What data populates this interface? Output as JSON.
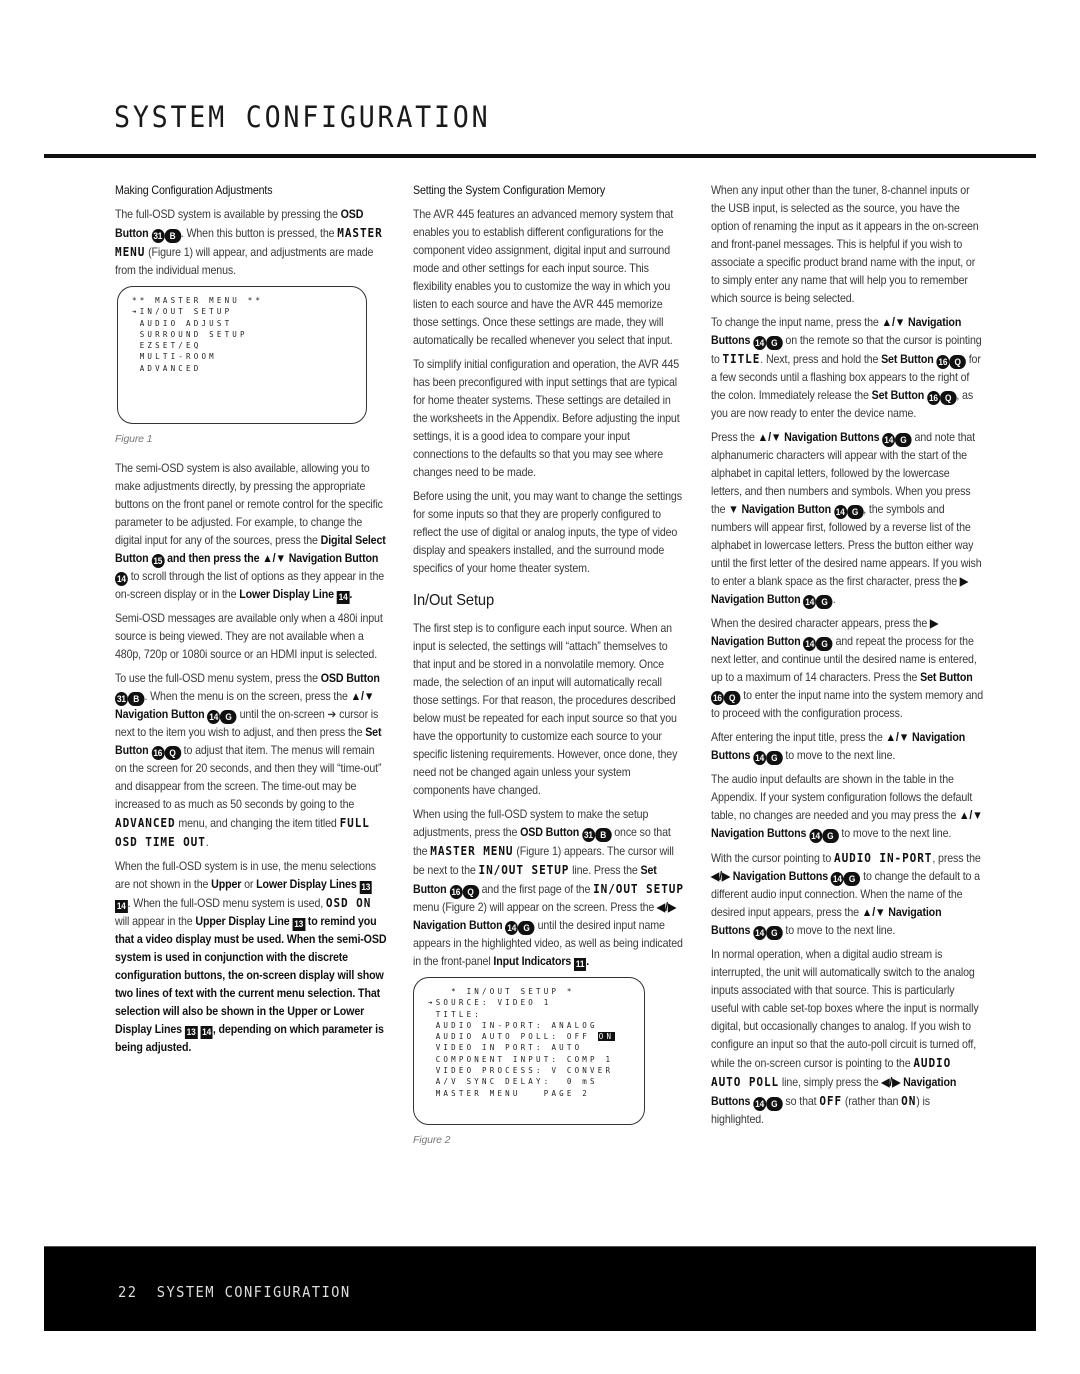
{
  "header": {
    "title": "SYSTEM CONFIGURATION"
  },
  "column1": {
    "heading": "Making Configuration Adjustments",
    "p1": [
      "The full-OSD system is available by pressing the ",
      "OSD Button",
      "31",
      "B",
      ". When this button is pressed, the ",
      "MASTER MENU",
      " (Figure 1) will appear, and adjustments are made from the individual menus."
    ],
    "figure1": {
      "lines": [
        "** MASTER MENU **",
        "",
        "→IN/OUT SETUP",
        " AUDIO ADJUST",
        " SURROUND SETUP",
        " EZSET/EQ",
        " MULTI-ROOM",
        " ADVANCED"
      ],
      "caption": "Figure 1"
    },
    "p2": [
      "The semi-OSD system is also available, allowing you to make adjustments directly, by pressing the appropriate buttons on the front panel or remote control for the specific parameter to be adjusted. For example, to change the digital input for any of the sources, press the ",
      "Digital Select Button",
      "15",
      " and then press the ",
      "▲/▼ Navigation Button",
      "14",
      " to scroll through the list of options as they appear in the on-screen display or in the ",
      "Lower Display Line",
      "14",
      "."
    ],
    "p3": "Semi-OSD messages are available only when a 480i input source is being viewed. They are not available when a 480p, 720p or 1080i source or an HDMI input is selected.",
    "p4": [
      "To use the full-OSD menu system, press the ",
      "OSD Button",
      "31",
      "B",
      ". When the menu is on the screen, press the ",
      "▲/▼ Navigation Button",
      "14",
      "G",
      " until the on-screen ➔ cursor is next to the item you wish to adjust, and then press the ",
      "Set Button",
      "16",
      "Q",
      " to adjust that item. The menus will remain on the screen for 20 seconds, and then they will “time-out” and disappear from the screen. The time-out may be increased to as much as 50 seconds by going to the ",
      "ADVANCED",
      " menu, and changing the item titled ",
      "FULL OSD TIME OUT",
      "."
    ],
    "p5": [
      "When the full-OSD system is in use, the menu selections are not shown in the ",
      "Upper",
      " or ",
      "Lower Display Lines",
      "13",
      "14",
      ". When the full-OSD menu system is used, ",
      "OSD ON",
      " will appear in the ",
      "Upper Display Line",
      "13",
      " to remind you that a video display must be used. When the semi-OSD system is used in conjunction with the discrete configuration buttons, the on-screen display will show two lines of text with the current menu selection. That selection will also be shown in the ",
      "Upper",
      " or ",
      "Lower Display Lines",
      "13",
      "14",
      ", depending on which parameter is being adjusted."
    ]
  },
  "column2": {
    "heading": "Setting the System Configuration Memory",
    "p1": "The AVR 445 features an advanced memory system that enables you to establish different configurations for the component video assignment, digital input and surround mode and other settings for each input source. This flexibility enables you to customize the way in which you listen to each source and have the AVR 445 memorize those settings. Once these settings are made, they will automatically be recalled whenever you select that input.",
    "p2": "To simplify initial configuration and operation, the AVR 445 has been preconfigured with input settings that are typical for home theater systems. These settings are detailed in the worksheets in the Appendix. Before adjusting the input settings, it is a good idea to compare your input connections to the defaults so that you may see where changes need to be made.",
    "p3": "Before using the unit, you may want to change the settings for some inputs so that they are properly configured to reflect the use of digital or analog inputs, the type of video display and speakers installed, and the surround mode specifics of your home theater system.",
    "section_title": "In/Out Setup",
    "p4": "The first step is to configure each input source. When an input is selected, the settings will “attach” themselves to that input and be stored in a nonvolatile memory. Once made, the selection of an input will automatically recall those settings. For that reason, the procedures described below must be repeated for each input source so that you have the opportunity to customize each source to your specific listening requirements. However, once done, they need not be changed again unless your system components have changed.",
    "p5": [
      "When using the full-OSD system to make the setup adjustments, press the ",
      "OSD Button",
      "31",
      "B",
      " once so that the ",
      "MASTER MENU",
      " (Figure 1) appears. The cursor will be next to the ",
      "IN/OUT SETUP",
      " line. Press the ",
      "Set Button",
      "16",
      "Q",
      " and the first page of the ",
      "IN/OUT SETUP",
      " menu (Figure 2) will appear on the screen. Press the ",
      "◀/▶ Navigation Button",
      "14",
      "G",
      " until the desired input name appears in the highlighted video, as well as being indicated in the front-panel ",
      "Input Indicators",
      "11",
      "."
    ],
    "figure2": {
      "lines": [
        "   * IN/OUT SETUP *",
        "→SOURCE: VIDEO 1",
        " TITLE:",
        " AUDIO IN-PORT: ANALOG",
        " AUDIO AUTO POLL: OFF ",
        " VIDEO IN PORT: AUTO",
        " COMPONENT INPUT: COMP 1",
        " VIDEO PROCESS: V CONVER",
        " A/V SYNC DELAY:  0 mS",
        " MASTER MENU   PAGE 2"
      ],
      "highlight": "ON",
      "caption": "Figure 2"
    }
  },
  "column3": {
    "p1": "When any input other than the tuner, 8-channel inputs or the USB input, is selected as the source, you have the option of renaming the input as it appears in the on-screen and front-panel messages. This is helpful if you wish to associate a specific product brand name with the input, or to simply enter any name that will help you to remember which source is being selected.",
    "p2": [
      "To change the input name, press the ",
      "▲/▼ Navigation Buttons",
      "14",
      "G",
      " on the remote so that the cursor is pointing to ",
      "TITLE",
      ". Next, press and hold the ",
      "Set Button",
      "16",
      "Q",
      " for a few seconds until a flashing box appears to the right of the colon. Immediately release the ",
      "Set Button",
      "16",
      "Q",
      ", as you are now ready to enter the device name."
    ],
    "p3": [
      "Press the ",
      "▲/▼ Navigation Buttons",
      "14",
      "G",
      " and note that alphanumeric characters will appear with the start of the alphabet in capital letters, followed by the lowercase letters, and then numbers and symbols. When you press the ",
      "▼ Navigation Button",
      "14",
      "G",
      ", the symbols and numbers will appear first, followed by a reverse list of the alphabet in lowercase letters. Press the button either way until the first letter of the desired name appears. If you wish to enter a blank space as the first character, press the ",
      "▶ Navigation Button",
      "14",
      "G",
      "."
    ],
    "p4": [
      "When the desired character appears, press the ",
      "▶ Navigation Button",
      "14",
      "G",
      " and repeat the process for the next letter, and continue until the desired name is entered, up to a maximum of 14 characters. Press the ",
      "Set Button",
      "16",
      "Q",
      " to enter the input name into the system memory and to proceed with the configuration process."
    ],
    "p5": [
      "After entering the input title, press the ",
      "▲/▼ Navigation Buttons",
      "14",
      "G",
      " to move to the next line."
    ],
    "p6": [
      "The audio input defaults are shown in the table in the Appendix. If your system configuration follows the default table, no changes are needed and you may press the ",
      "▲/▼ Navigation Buttons",
      "14",
      "G",
      " to move to the next line."
    ],
    "p7": [
      "With the cursor pointing to ",
      "AUDIO IN-PORT",
      ", press the ",
      "◀/▶ Navigation Buttons",
      "14",
      "G",
      " to change the default to a different audio input connection. When the name of the desired input appears, press the ",
      "▲/▼ Navigation Buttons",
      "14",
      "G",
      " to move to the next line."
    ],
    "p8": [
      "In normal operation, when a digital audio stream is interrupted, the unit will automatically switch to the analog inputs associated with that source. This is particularly useful with cable set-top boxes where the input is normally digital, but occasionally changes to analog. If you wish to configure an input so that the auto-poll circuit is turned off, while the on-screen cursor is pointing to the ",
      "AUDIO AUTO POLL",
      " line, simply press the ",
      "◀/▶ Navigation Buttons",
      "14",
      "G",
      " so that ",
      "OFF",
      " (rather than ",
      "ON",
      ") is highlighted."
    ]
  },
  "footer": {
    "page_number": "22",
    "section": "SYSTEM CONFIGURATION"
  }
}
